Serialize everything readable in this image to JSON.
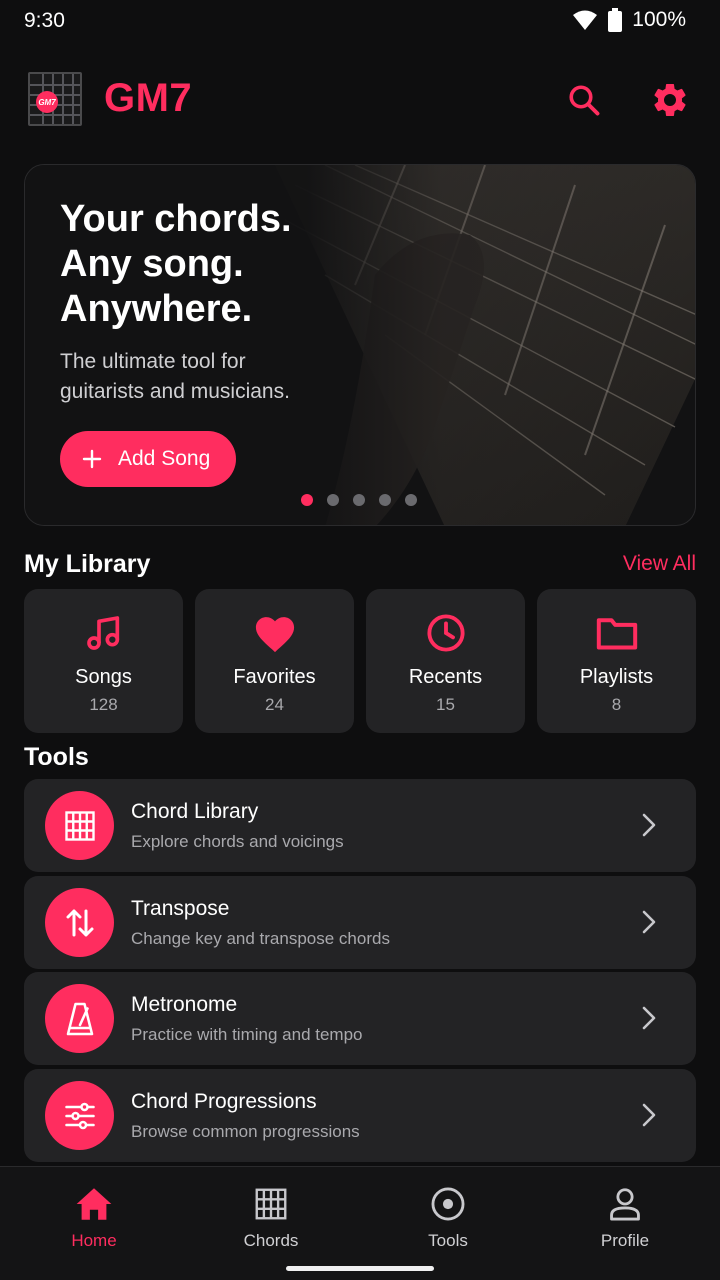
{
  "status_bar": {
    "time": "9:30",
    "battery": "100%"
  },
  "header": {
    "app_title": "GM7",
    "logo_text": "GM7"
  },
  "hero": {
    "headline": [
      "Your chords.",
      "Any song.",
      "Anywhere."
    ],
    "subtitle": [
      "The ultimate tool for",
      "guitarists and musicians."
    ],
    "cta_label": "Add Song",
    "carousel": {
      "count": 5,
      "active": 1
    }
  },
  "library": {
    "title": "My Library",
    "view_all": "View All",
    "cards": [
      {
        "label": "Songs",
        "count": "128",
        "icon": "music-note-icon"
      },
      {
        "label": "Favorites",
        "count": "24",
        "icon": "heart-icon"
      },
      {
        "label": "Recents",
        "count": "15",
        "icon": "clock-icon"
      },
      {
        "label": "Playlists",
        "count": "8",
        "icon": "folder-icon"
      }
    ]
  },
  "tools": {
    "title": "Tools",
    "items": [
      {
        "title": "Chord Library",
        "desc": "Explore chords and voicings",
        "icon": "chord-grid-icon"
      },
      {
        "title": "Transpose",
        "desc": "Change key and transpose chords",
        "icon": "transpose-arrows-icon"
      },
      {
        "title": "Metronome",
        "desc": "Practice with timing and tempo",
        "icon": "metronome-icon"
      },
      {
        "title": "Chord Progressions",
        "desc": "Browse common progressions",
        "icon": "sliders-icon"
      }
    ]
  },
  "bottom_nav": {
    "items": [
      {
        "label": "Home",
        "icon": "home-icon",
        "active": true
      },
      {
        "label": "Chords",
        "icon": "chord-grid-icon",
        "active": false
      },
      {
        "label": "Tools",
        "icon": "target-icon",
        "active": false
      },
      {
        "label": "Profile",
        "icon": "person-icon",
        "active": false
      }
    ]
  },
  "colors": {
    "accent": "#ff2d5f",
    "background": "#0e0e0f",
    "card": "#232325",
    "muted_text": "#a9a9ad"
  }
}
